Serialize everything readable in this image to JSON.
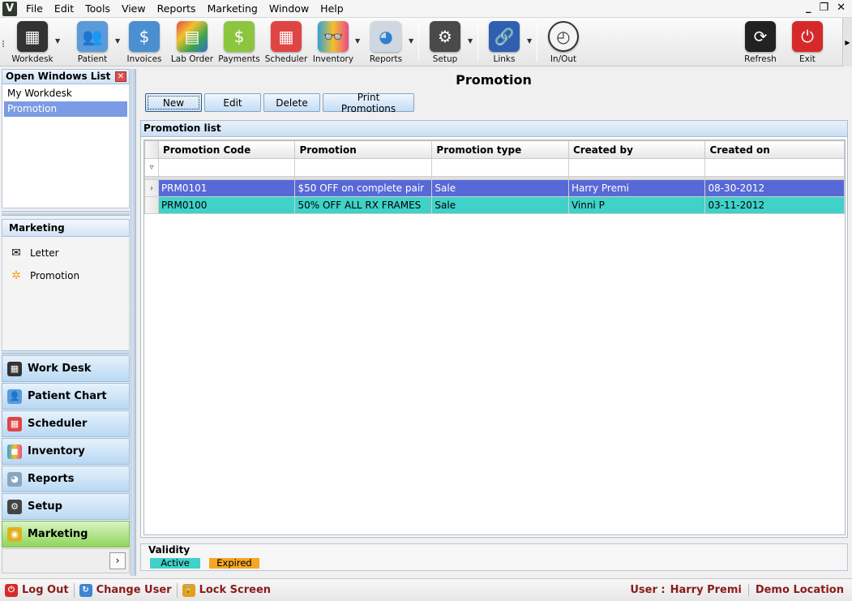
{
  "app": {
    "logo_letter": "V"
  },
  "menu": [
    "File",
    "Edit",
    "Tools",
    "View",
    "Reports",
    "Marketing",
    "Window",
    "Help"
  ],
  "window_controls": {
    "minimize": "_",
    "restore": "❐",
    "close": "✕"
  },
  "toolbar": {
    "workdesk": "Workdesk",
    "patient": "Patient",
    "invoices": "Invoices",
    "lab_order": "Lab Order",
    "payments": "Payments",
    "scheduler": "Scheduler",
    "inventory": "Inventory",
    "reports": "Reports",
    "setup": "Setup",
    "links": "Links",
    "in_out": "In/Out",
    "refresh": "Refresh",
    "exit": "Exit"
  },
  "open_windows": {
    "title": "Open Windows List",
    "items": [
      "My Workdesk",
      "Promotion"
    ],
    "selected": "Promotion"
  },
  "marketing": {
    "title": "Marketing",
    "items": [
      "Letter",
      "Promotion"
    ]
  },
  "nav": [
    "Work Desk",
    "Patient Chart",
    "Scheduler",
    "Inventory",
    "Reports",
    "Setup",
    "Marketing"
  ],
  "nav_active": "Marketing",
  "main": {
    "title": "Promotion",
    "buttons": {
      "new": "New",
      "edit": "Edit",
      "delete": "Delete",
      "print": "Print Promotions"
    },
    "list_caption": "Promotion list",
    "columns": [
      "Promotion Code",
      "Promotion",
      "Promotion type",
      "Created by",
      "Created on"
    ],
    "rows": [
      {
        "code": "PRM0101",
        "promotion": "$50 OFF on complete pair",
        "type": "Sale",
        "created_by": "Harry Premi",
        "created_on": "08-30-2012"
      },
      {
        "code": "PRM0100",
        "promotion": "50% OFF ALL RX FRAMES",
        "type": "Sale",
        "created_by": "Vinni P",
        "created_on": "03-11-2012"
      }
    ],
    "validity": {
      "label": "Validity",
      "active": "Active",
      "expired": "Expired"
    }
  },
  "status": {
    "logout": "Log Out",
    "change_user": "Change User",
    "lock_screen": "Lock Screen",
    "user_label": "User :",
    "user_name": "Harry Premi",
    "location": "Demo Location"
  },
  "colors": {
    "row_selected": "#5869d7",
    "row_active": "#40d1c8",
    "active_chip": "#40d1c8",
    "expired_chip": "#f5a623",
    "nav_active": "#8fd65b"
  }
}
